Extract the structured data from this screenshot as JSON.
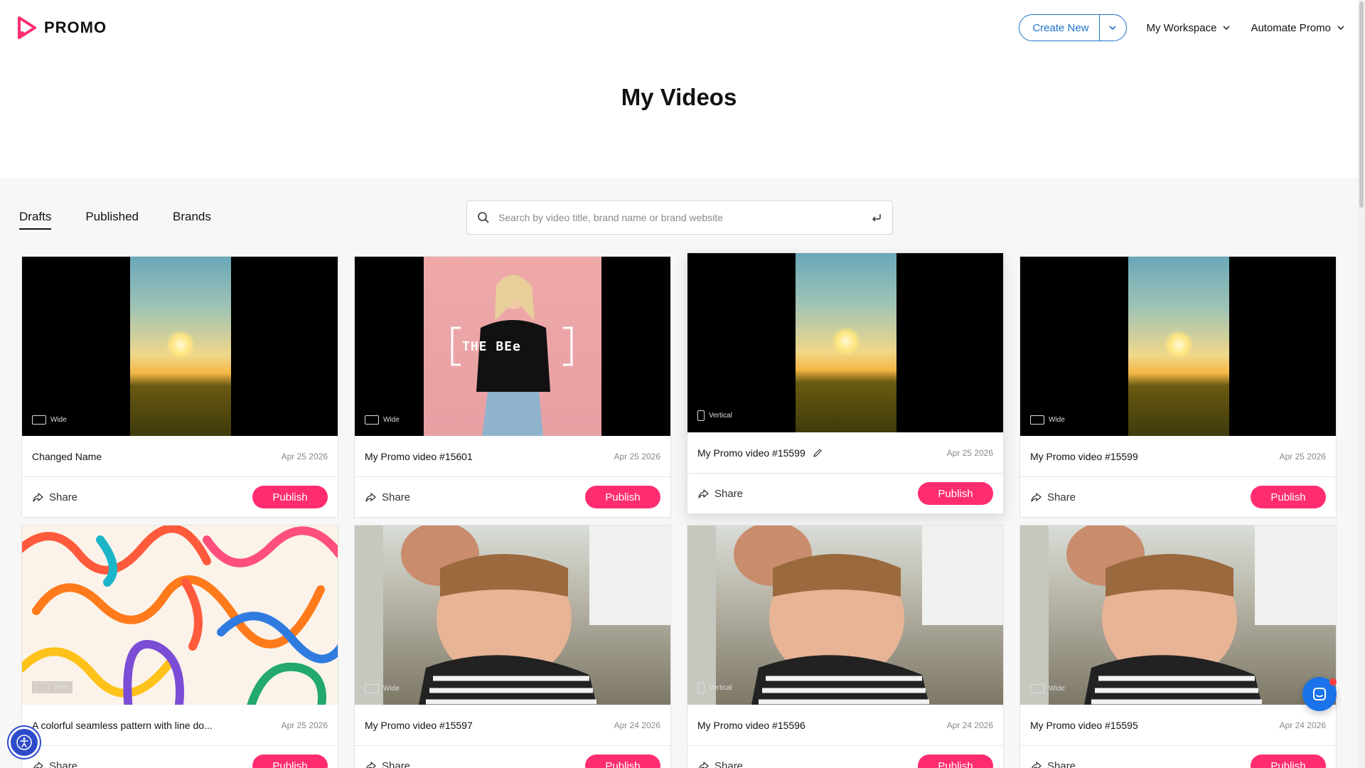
{
  "header": {
    "logo_text": "PROMO",
    "create_new_label": "Create New",
    "workspace_label": "My Workspace",
    "automate_label": "Automate Promo"
  },
  "page_title": "My Videos",
  "tabs": [
    {
      "label": "Drafts",
      "active": true
    },
    {
      "label": "Published",
      "active": false
    },
    {
      "label": "Brands",
      "active": false
    }
  ],
  "search": {
    "placeholder": "Search by video title, brand name or brand website",
    "value": ""
  },
  "colors": {
    "accent_blue": "#1e72c8",
    "publish_pink": "#ff2d6f"
  },
  "cards": [
    {
      "title": "Changed Name",
      "date": "Apr 25 2026",
      "format": "Wide",
      "thumb": "sunflower",
      "share_label": "Share",
      "publish_label": "Publish"
    },
    {
      "title": "My Promo video #15601",
      "date": "Apr 25 2026",
      "format": "Wide",
      "thumb": "pink",
      "share_label": "Share",
      "publish_label": "Publish"
    },
    {
      "title": "My Promo video #15599",
      "date": "Apr 25 2026",
      "format": "Vertical",
      "thumb": "sunflower",
      "share_label": "Share",
      "publish_label": "Publish",
      "hovered": true
    },
    {
      "title": "My Promo video #15599",
      "date": "Apr 25 2026",
      "format": "Wide",
      "thumb": "sunflower",
      "share_label": "Share",
      "publish_label": "Publish"
    },
    {
      "title": "A colorful seamless pattern with line do...",
      "date": "Apr 25 2026",
      "format": "Wide",
      "thumb": "pattern",
      "share_label": "Share",
      "publish_label": "Publish"
    },
    {
      "title": "My Promo video #15597",
      "date": "Apr 24 2026",
      "format": "Wide",
      "thumb": "kid",
      "share_label": "Share",
      "publish_label": "Publish"
    },
    {
      "title": "My Promo video #15596",
      "date": "Apr 24 2026",
      "format": "Vertical",
      "thumb": "kid",
      "share_label": "Share",
      "publish_label": "Publish"
    },
    {
      "title": "My Promo video #15595",
      "date": "Apr 24 2026",
      "format": "Wide",
      "thumb": "kid",
      "share_label": "Share",
      "publish_label": "Publish"
    }
  ],
  "thumb_text": {
    "pink_overlay": "THE BEe"
  },
  "icons": {
    "search": "search-icon",
    "enter": "enter-icon",
    "share": "share-icon",
    "edit": "pencil-icon",
    "chevron": "chevron-down-icon",
    "accessibility": "accessibility-icon",
    "chat": "chat-icon"
  }
}
